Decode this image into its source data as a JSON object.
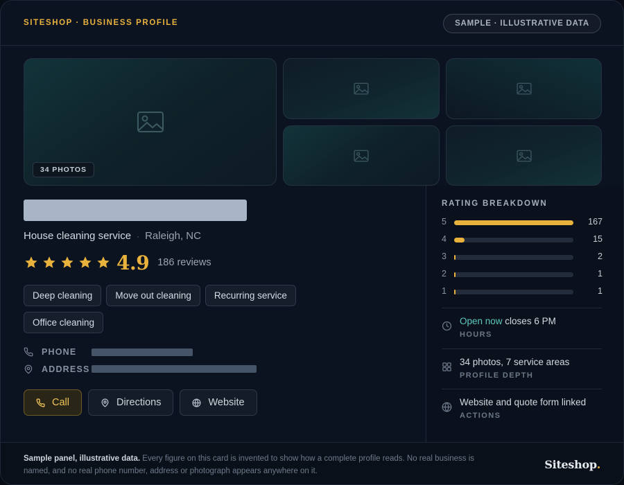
{
  "header": {
    "brand_line": "SITESHOP · BUSINESS PROFILE",
    "sample_badge": "SAMPLE · ILLUSTRATIVE DATA"
  },
  "photos": {
    "count_label": "34 PHOTOS",
    "tile_icon": "image-placeholder-icon"
  },
  "business": {
    "category": "House cleaning service",
    "separator": "·",
    "location": "Raleigh, NC",
    "rating": "4.9",
    "stars": 5,
    "review_count": "186 reviews",
    "tags": [
      "Deep cleaning",
      "Move out cleaning",
      "Recurring service",
      "Office cleaning"
    ]
  },
  "contact": {
    "phone_label": "PHONE",
    "address_label": "ADDRESS",
    "phone_icon": "phone-icon",
    "address_icon": "map-pin-icon"
  },
  "actions": {
    "call": "Call",
    "directions": "Directions",
    "website": "Website"
  },
  "rating_breakdown": {
    "title": "RATING BREAKDOWN",
    "rows": [
      {
        "stars": "5",
        "count": "167",
        "value": 167
      },
      {
        "stars": "4",
        "count": "15",
        "value": 15
      },
      {
        "stars": "3",
        "count": "2",
        "value": 2
      },
      {
        "stars": "2",
        "count": "1",
        "value": 1
      },
      {
        "stars": "1",
        "count": "1",
        "value": 1
      }
    ]
  },
  "info": {
    "hours_open": "Open now",
    "hours_close": " closes 6 PM",
    "hours_label": "HOURS",
    "depth_main": "34 photos, 7 service areas",
    "depth_label": "PROFILE DEPTH",
    "actions_main": "Website and quote form linked",
    "actions_label": "ACTIONS"
  },
  "footer": {
    "lead": "Sample panel, illustrative data.",
    "text": " Every figure on this card is invented to show how a complete profile reads. No real business is named, and no real phone number, address or photograph appears anywhere on it.",
    "logo": "Siteshop",
    "logo_dot": "."
  },
  "colors": {
    "accent": "#e8b23d",
    "open_status": "#5cc8bd",
    "background": "#0c1320"
  }
}
